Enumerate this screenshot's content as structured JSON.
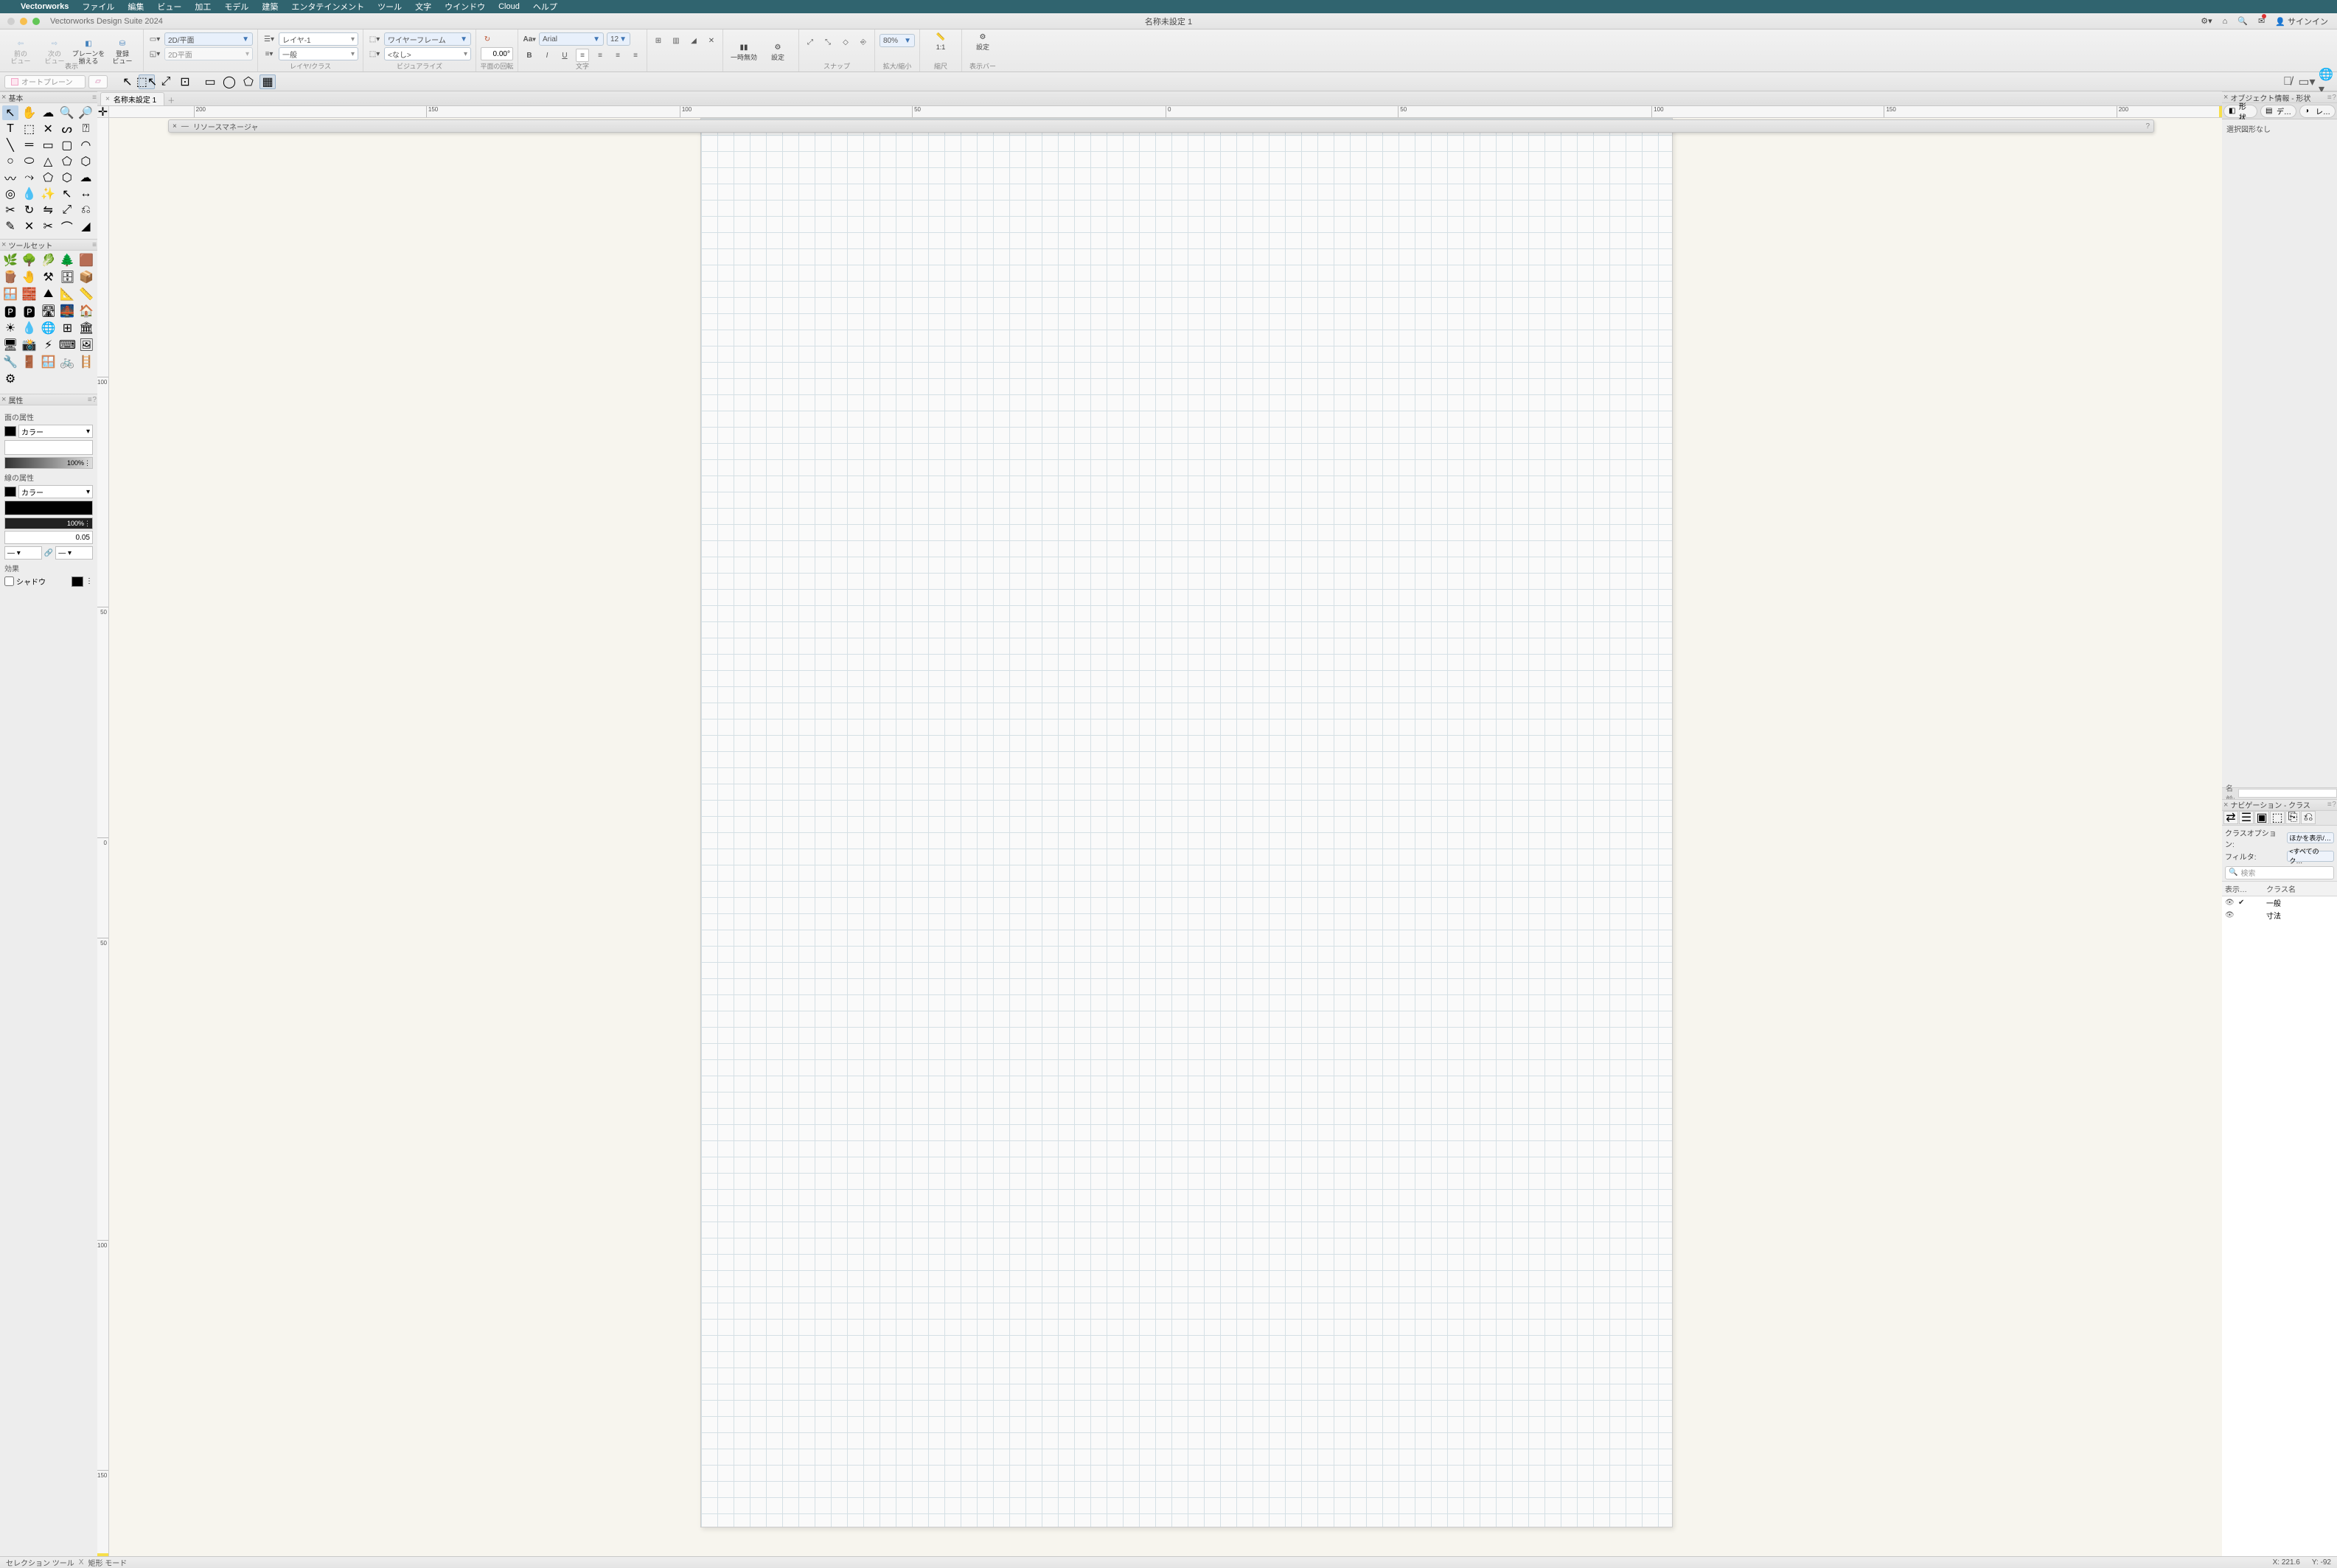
{
  "menu": {
    "app": "Vectorworks",
    "items": [
      "ファイル",
      "編集",
      "ビュー",
      "加工",
      "モデル",
      "建築",
      "エンタテインメント",
      "ツール",
      "文字",
      "ウインドウ",
      "Cloud",
      "ヘルプ"
    ]
  },
  "titlebar": {
    "app_title": "Vectorworks Design Suite 2024",
    "doc_title": "名称未設定 1",
    "signin": "サインイン"
  },
  "ribbon": {
    "view_section": "表示",
    "prev_view": "前の\nビュー",
    "next_view": "次の\nビュー",
    "fit_plane": "プレーンを\n揃える",
    "saved_view": "登録\nビュー",
    "view_sel_top": "2D/平面",
    "view_sel_bot": "2D平面",
    "layer_section": "レイヤ/クラス",
    "layer_sel": "レイヤ-1",
    "class_sel": "一般",
    "visualize_section": "ビジュアライズ",
    "render_sel": "ワイヤーフレーム",
    "render_sel2": "<なし>",
    "rot_section": "平面の回転",
    "rot_val": "0.00°",
    "text_section": "文字",
    "font": "Arial",
    "font_size": "12",
    "pause_section": "一時無効",
    "settings_section": "設定",
    "snap_section": "スナップ",
    "zoom_section": "拡大/縮小",
    "zoom": "80%",
    "scale_section": "縮尺",
    "scale": "1:1",
    "bar_section": "表示バー",
    "bar_settings": "設定"
  },
  "toolbar2": {
    "autoplane": "オートプレーン"
  },
  "palettes": {
    "basic": "基本",
    "toolset": "ツールセット",
    "attributes": "属性",
    "attr_face": "面の属性",
    "attr_line": "線の属性",
    "attr_color": "カラー",
    "attr_100": "100%",
    "attr_lw": "0.05",
    "attr_effects": "効果",
    "attr_shadow": "シャドウ"
  },
  "doc": {
    "tab": "名称未設定 1",
    "resource_mgr": "リソースマネージャ",
    "ruler_h": [
      "200",
      "150",
      "100",
      "50",
      "0",
      "50",
      "100",
      "150",
      "200"
    ],
    "ruler_v": [
      "100",
      "50",
      "0",
      "50",
      "100",
      "150"
    ]
  },
  "right": {
    "objinfo_title": "オブジェクト情報 - 形状",
    "tab_shape": "形状",
    "tab_data": "デ…",
    "tab_render": "レ…",
    "no_sel": "選択図形なし",
    "name_label": "名前:",
    "nav_title": "ナビゲーション - クラス",
    "class_opt_label": "クラスオプション:",
    "class_opt_val": "ほかを表示/…",
    "filter_label": "フィルタ:",
    "filter_val": "<すべてのク…",
    "search_ph": "検索",
    "col_vis": "表示…",
    "col_name": "クラス名",
    "classes": [
      "一般",
      "寸法"
    ]
  },
  "status": {
    "tool": "セレクション ツール",
    "mode": "矩形 モード",
    "x": "X: 221.6",
    "y": "Y: -92"
  }
}
